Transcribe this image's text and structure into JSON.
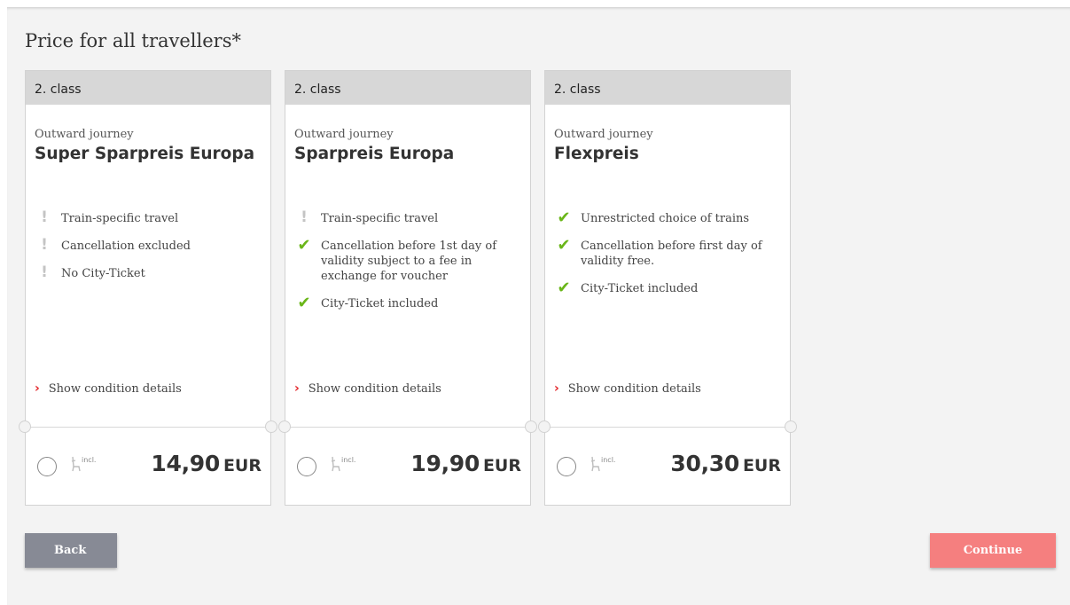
{
  "heading": "Price for all travellers*",
  "cards": [
    {
      "class_label": "2. class",
      "journey_label": "Outward journey",
      "title": "Super Sparpreis Europa",
      "features": [
        {
          "icon": "exclamation-icon",
          "text": "Train-specific travel"
        },
        {
          "icon": "exclamation-icon",
          "text": "Cancellation excluded"
        },
        {
          "icon": "exclamation-icon",
          "text": "No City-Ticket"
        }
      ],
      "details_link": "Show condition details",
      "seat_label": "incl.",
      "price_amount": "14,90",
      "price_currency": "EUR"
    },
    {
      "class_label": "2. class",
      "journey_label": "Outward journey",
      "title": "Sparpreis Europa",
      "features": [
        {
          "icon": "exclamation-icon",
          "text": "Train-specific travel"
        },
        {
          "icon": "check-icon",
          "text": "Cancellation before 1st day of validity subject to a fee in exchange for voucher"
        },
        {
          "icon": "check-icon",
          "text": "City-Ticket included"
        }
      ],
      "details_link": "Show condition details",
      "seat_label": "incl.",
      "price_amount": "19,90",
      "price_currency": "EUR"
    },
    {
      "class_label": "2. class",
      "journey_label": "Outward journey",
      "title": "Flexpreis",
      "features": [
        {
          "icon": "check-icon",
          "text": "Unrestricted choice of trains"
        },
        {
          "icon": "check-icon",
          "text": "Cancellation before first day of validity free."
        },
        {
          "icon": "check-icon",
          "text": "City-Ticket included"
        }
      ],
      "details_link": "Show condition details",
      "seat_label": "incl.",
      "price_amount": "30,30",
      "price_currency": "EUR"
    }
  ],
  "buttons": {
    "back": "Back",
    "continue": "Continue"
  },
  "colors": {
    "accent_red": "#e3262a",
    "check_green": "#6ab619",
    "continue_bg": "#f57f7f",
    "back_bg": "#878a95"
  }
}
